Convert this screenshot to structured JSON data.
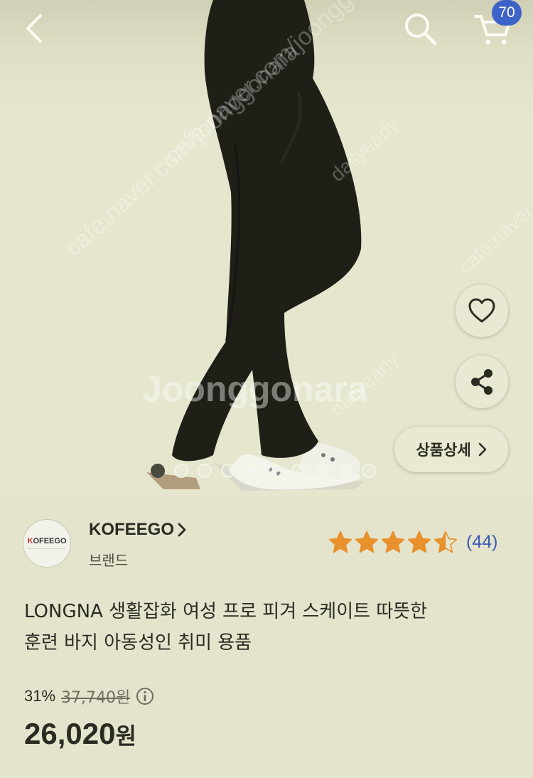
{
  "header": {
    "cart_count": "70"
  },
  "gallery": {
    "image_count": 10,
    "active_index": 0,
    "watermark_main": "Joonggonara",
    "watermark_url": "cafe.naver.com/joonggonara",
    "watermark_small": "dailyearly",
    "detail_button_label": "상품상세"
  },
  "brand": {
    "name": "KOFEEGO",
    "type": "브랜드",
    "logo_text": "KOFEEGO"
  },
  "rating": {
    "stars": 4.5,
    "max_stars": 5,
    "review_count": "(44)",
    "star_color": "#e8902c"
  },
  "product": {
    "title_line1": "LONGNA 생활잡화 여성 프로 피겨 스케이트 따뜻한",
    "title_line2": "훈련 바지 아동성인 취미 용품"
  },
  "price": {
    "discount_rate": "31%",
    "original_price": "37,740원",
    "sale_price_number": "26,020",
    "sale_price_unit": "원"
  },
  "colors": {
    "background": "#e4e4cd",
    "accent_blue": "#3e63c8",
    "link_blue": "#3d59b5"
  }
}
